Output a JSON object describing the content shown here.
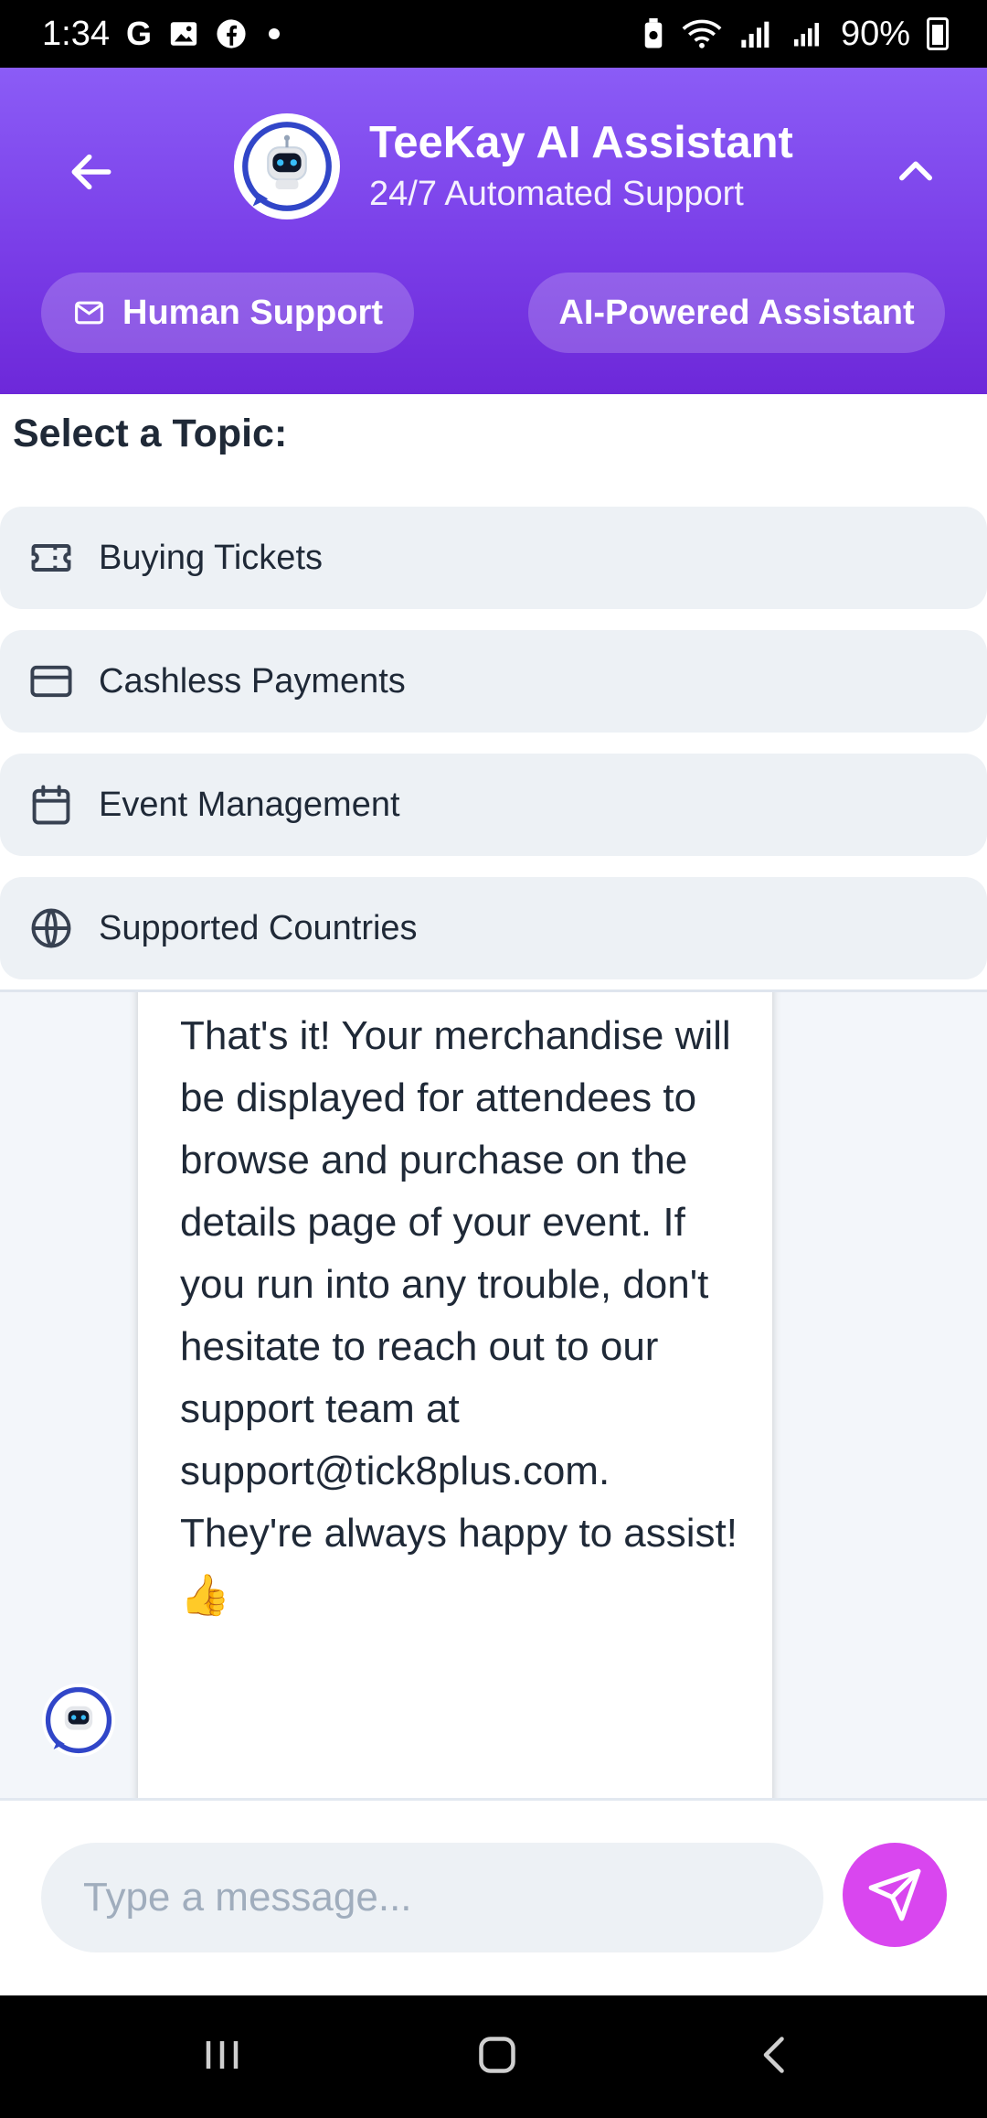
{
  "status_bar": {
    "time": "1:34",
    "notification_icons": [
      "G",
      "image-icon",
      "facebook-icon"
    ],
    "battery_percent": "90%"
  },
  "header": {
    "title": "TeeKay AI Assistant",
    "subtitle": "24/7 Automated Support",
    "buttons": {
      "human_support": "Human Support",
      "ai_assistant": "AI-Powered Assistant"
    },
    "colors": {
      "gradient_top": "#8b5cf6",
      "gradient_bottom": "#6d28d9"
    }
  },
  "topics": {
    "title": "Select a Topic:",
    "items": [
      {
        "label": "Buying Tickets",
        "icon": "ticket-icon"
      },
      {
        "label": "Cashless Payments",
        "icon": "credit-card-icon"
      },
      {
        "label": "Event Management",
        "icon": "calendar-icon"
      },
      {
        "label": "Supported Countries",
        "icon": "globe-icon"
      }
    ]
  },
  "chat": {
    "messages": [
      {
        "sender": "assistant",
        "text": "That's it! Your merchandise will be displayed for attendees to browse and purchase on the details page of your event. If you run into any trouble, don't hesitate to reach out to our support team at support@tick8plus.com. They're always happy to assist! 👍"
      }
    ]
  },
  "composer": {
    "placeholder": "Type a message...",
    "value": "",
    "send_color": "#d946ef"
  }
}
